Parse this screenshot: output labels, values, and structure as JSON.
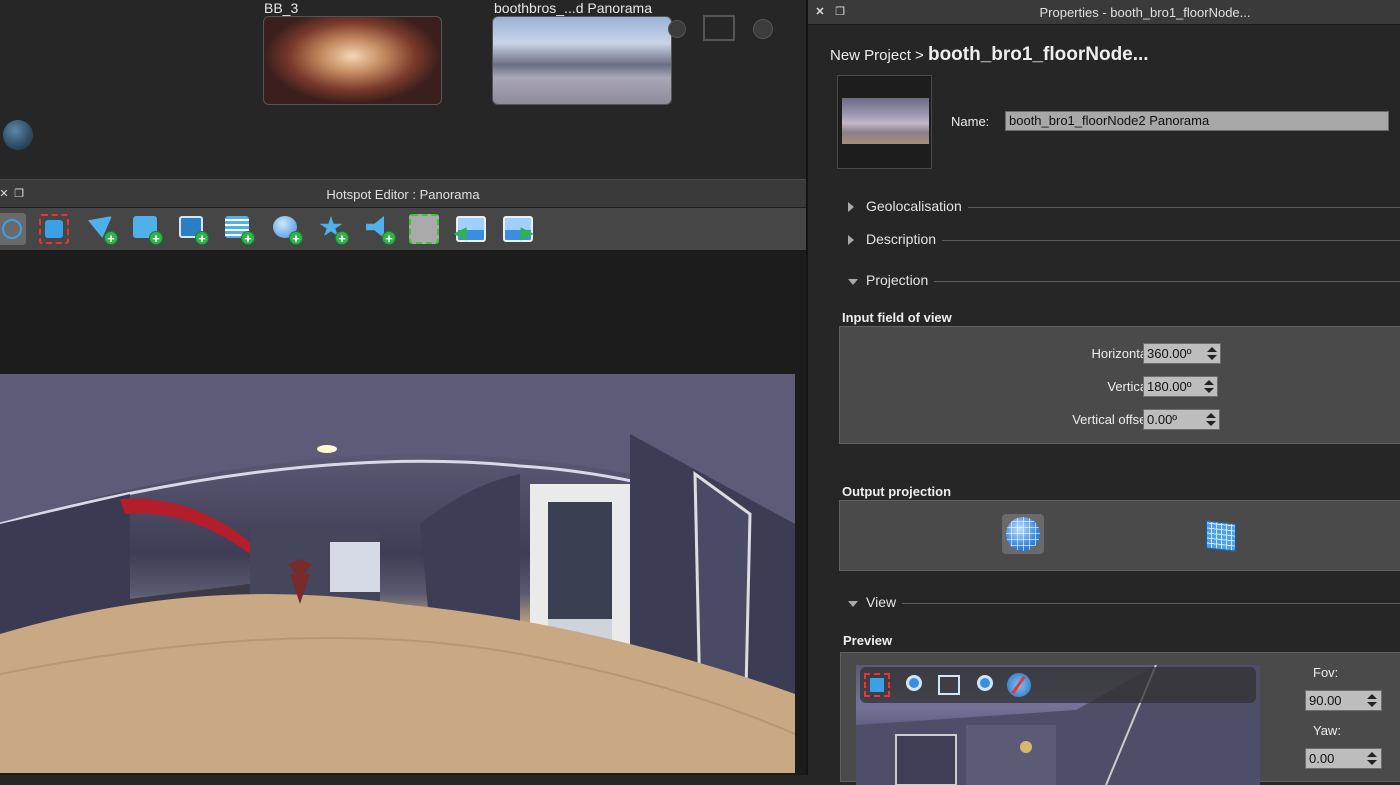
{
  "thumbnails": {
    "first_label": "BB_3",
    "second_label": "boothbros_...d Panorama"
  },
  "hotspot_editor": {
    "title": "Hotspot Editor : Panorama",
    "tools": [
      "move-icon",
      "select-area-icon",
      "add-point-hotspot-icon",
      "add-photo-hotspot-icon",
      "add-video-hotspot-icon",
      "add-text-hotspot-icon",
      "add-circle-hotspot-icon",
      "add-star-hotspot-icon",
      "add-sound-hotspot-icon",
      "add-polygon-hotspot-icon",
      "previous-panorama-icon",
      "next-panorama-icon"
    ]
  },
  "properties": {
    "title": "Properties - booth_bro1_floorNode...",
    "breadcrumb_root": "New Project >",
    "breadcrumb_current": "booth_bro1_floorNode...",
    "name_label": "Name:",
    "name_value": "booth_bro1_floorNode2 Panorama",
    "sections": {
      "geolocalisation": "Geolocalisation",
      "description": "Description",
      "projection": "Projection",
      "view": "View"
    },
    "input_fov": {
      "heading": "Input field of view",
      "horizontal_label": "Horizontal",
      "horizontal_value": "360.00º",
      "vertical_label": "Vertical",
      "vertical_value": "180.00º",
      "offset_label": "Vertical offset",
      "offset_value": "0.00º"
    },
    "output_projection": {
      "heading": "Output projection",
      "options": [
        "sphere-projection-icon",
        "flat-projection-icon"
      ]
    },
    "preview": {
      "heading": "Preview",
      "fov_label": "Fov:",
      "fov_value": "90.00",
      "yaw_label": "Yaw:",
      "yaw_value": "0.00"
    }
  },
  "colors": {
    "plus_badge": "#2fb44a",
    "panel_bg": "#262626",
    "group_bg": "#4a4a4a"
  }
}
